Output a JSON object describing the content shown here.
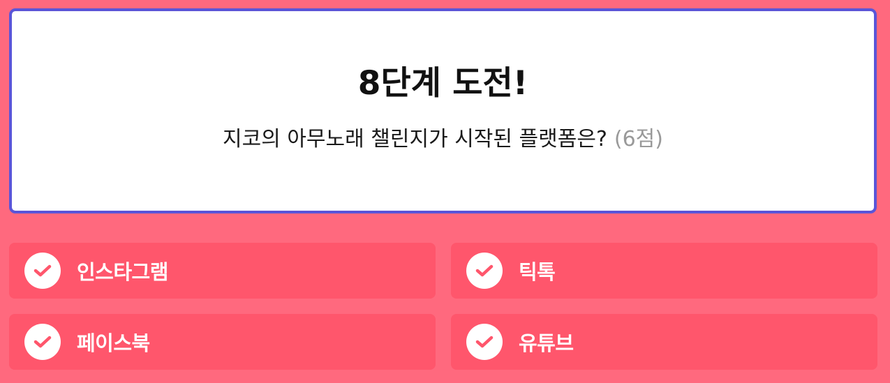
{
  "question": {
    "stage_title": "8단계 도전!",
    "text": "지코의 아무노래 챌린지가 시작된 플랫폼은?",
    "points": "(6점)"
  },
  "options": [
    {
      "label": "인스타그램"
    },
    {
      "label": "틱톡"
    },
    {
      "label": "페이스북"
    },
    {
      "label": "유튜브"
    }
  ],
  "colors": {
    "background": "#ff697e",
    "option_bg": "#ff566c",
    "card_border": "#5a55d8",
    "check_mark": "#ff566c"
  },
  "icons": {
    "option_check": "check-circle-icon"
  }
}
